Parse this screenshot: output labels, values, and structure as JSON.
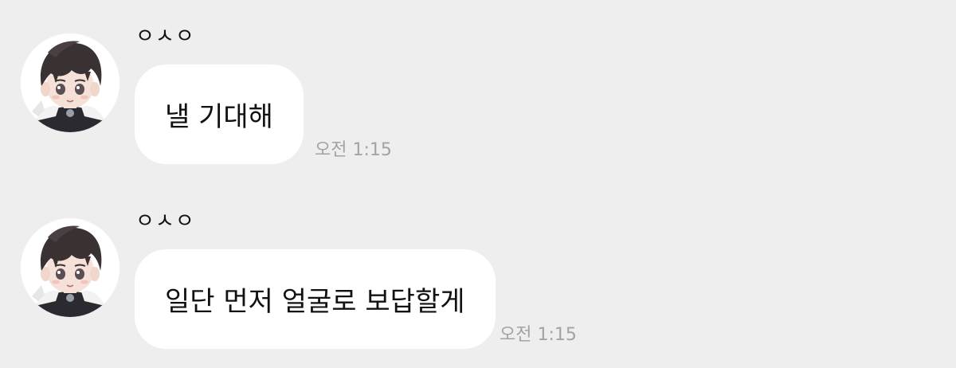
{
  "chat": {
    "messages": [
      {
        "sender": "ㅇㅅㅇ",
        "avatar_icon": "profile-avatar",
        "text": "낼 기대해",
        "time": "오전 1:15"
      },
      {
        "sender": "ㅇㅅㅇ",
        "avatar_icon": "profile-avatar",
        "text": "일단 먼저 얼굴로 보답할게",
        "time": "오전 1:15"
      }
    ]
  },
  "colors": {
    "background": "#eeeeee",
    "bubble": "#ffffff",
    "text": "#111111",
    "timestamp": "#a3a3a3"
  }
}
